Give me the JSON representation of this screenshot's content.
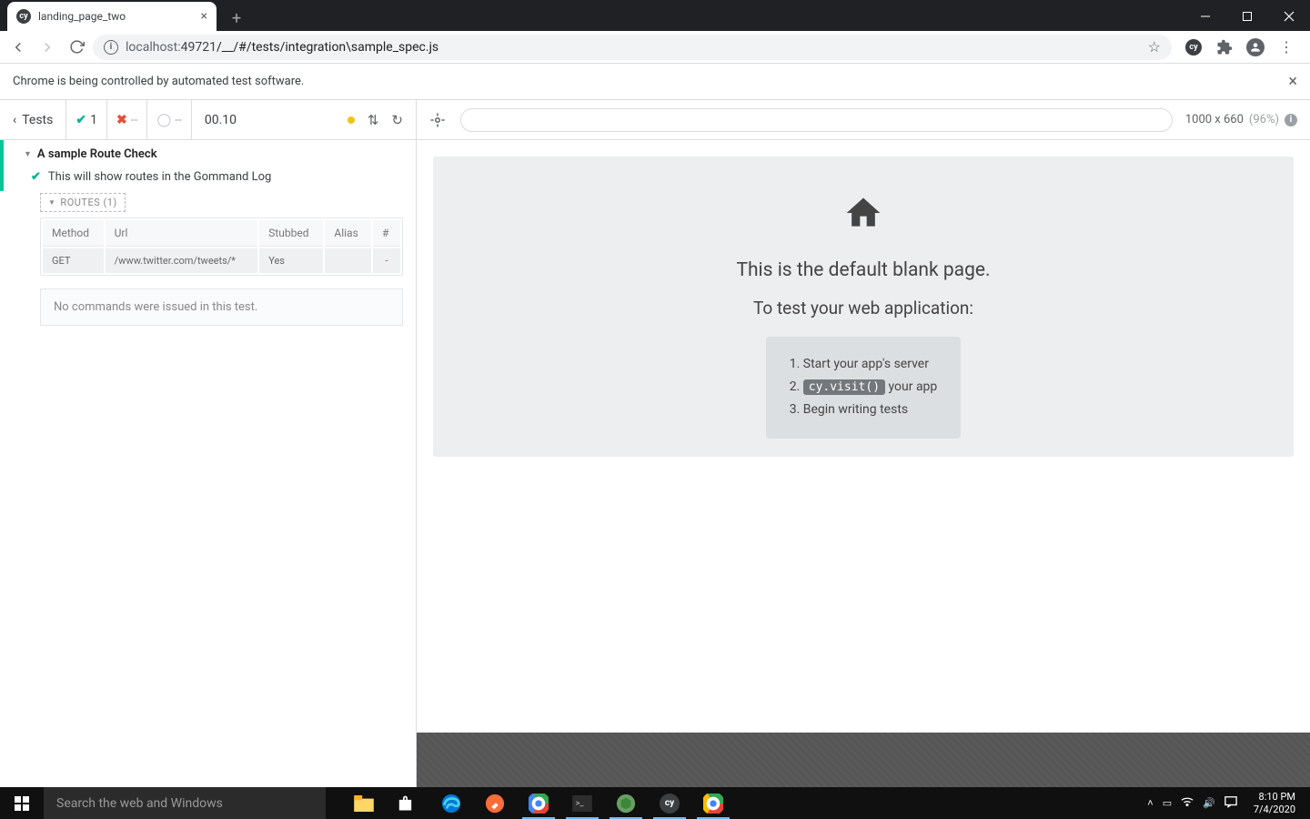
{
  "browser": {
    "tab_title": "landing_page_two",
    "url_host": "localhost:",
    "url_port": "49721",
    "url_path": "/__/#/tests/integration\\sample_spec.js",
    "info_bar": "Chrome is being controlled by automated test software."
  },
  "cypress": {
    "tests_label": "Tests",
    "passed": "1",
    "failed": "--",
    "pending": "--",
    "time": "00.10",
    "describe": "A sample Route Check",
    "it": "This will show routes in the Gommand Log",
    "routes_label": "ROUTES (1)",
    "routes_headers": {
      "method": "Method",
      "url": "Url",
      "stubbed": "Stubbed",
      "alias": "Alias",
      "hash": "#"
    },
    "routes_row": {
      "method": "GET",
      "url": "/www.twitter.com/tweets/*",
      "stubbed": "Yes",
      "alias": "",
      "hash": "-"
    },
    "no_commands": "No commands were issued in this test."
  },
  "aut": {
    "viewport": "1000 x 660",
    "scale": "(96%)",
    "blank_h2": "This is the default blank page.",
    "blank_h3": "To test your web application:",
    "step1": "Start your app's server",
    "step2_pre": "",
    "step2_code": "cy.visit()",
    "step2_post": " your app",
    "step3": "Begin writing tests"
  },
  "taskbar": {
    "search_placeholder": "Search the web and Windows",
    "time": "8:10 PM",
    "date": "7/4/2020"
  }
}
